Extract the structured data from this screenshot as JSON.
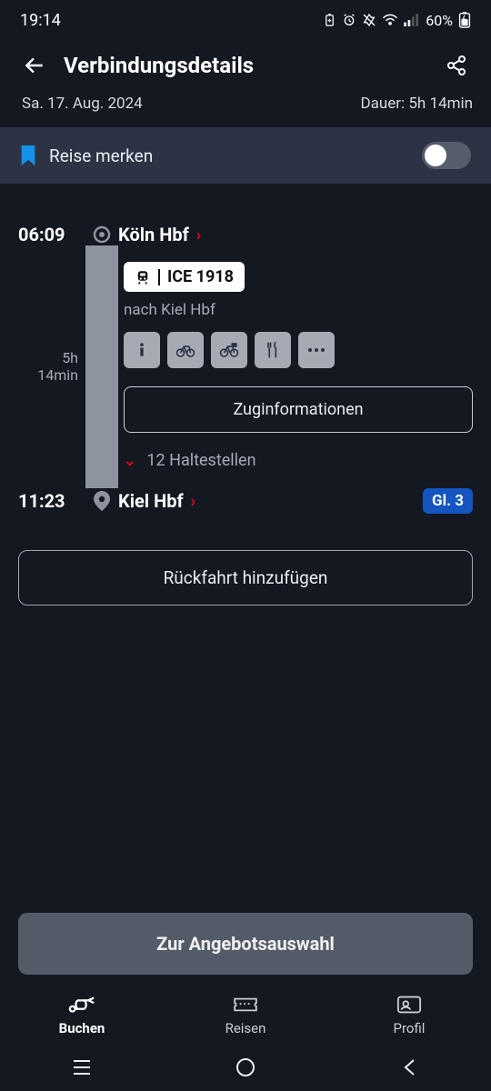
{
  "status": {
    "time": "19:14",
    "battery": "60%"
  },
  "header": {
    "title": "Verbindungsdetails"
  },
  "meta": {
    "date": "Sa. 17. Aug. 2024",
    "duration_label": "Dauer: 5h 14min"
  },
  "remember": {
    "label": "Reise merken"
  },
  "journey": {
    "depart_time": "06:09",
    "depart_station": "Köln Hbf",
    "train_label": "ICE 1918",
    "destination_line": "nach Kiel Hbf",
    "duration_a": "5h",
    "duration_b": "14min",
    "info_button": "Zuginformationen",
    "stops_count": "12 Haltestellen",
    "arrive_time": "11:23",
    "arrive_station": "Kiel Hbf",
    "platform": "Gl. 3"
  },
  "actions": {
    "add_return": "Rückfahrt hinzufügen",
    "to_offers": "Zur Angebotsauswahl"
  },
  "nav": {
    "book": "Buchen",
    "trips": "Reisen",
    "profile": "Profil"
  }
}
